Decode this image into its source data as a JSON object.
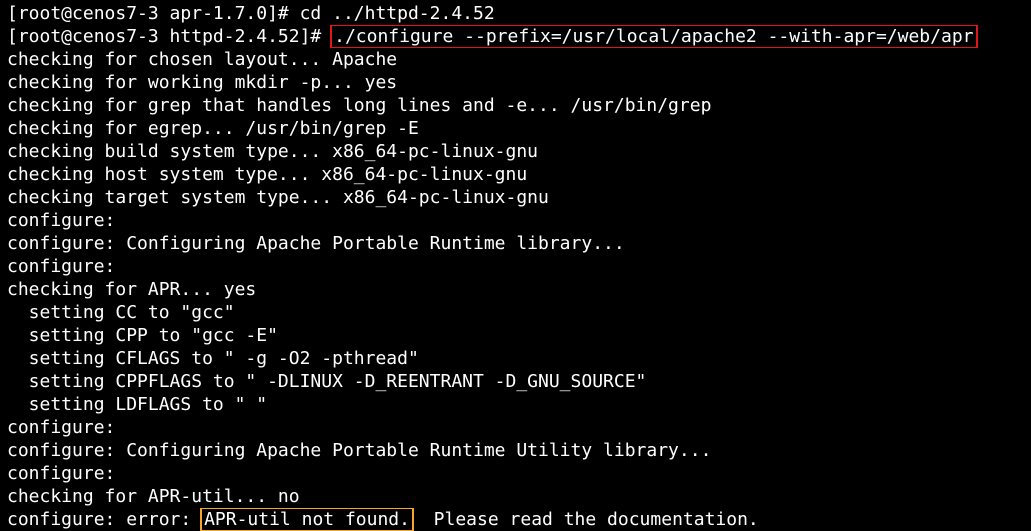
{
  "terminal": {
    "colors": {
      "background": "#000000",
      "foreground": "#ffffff",
      "highlight_red": "#e0161b",
      "highlight_orange": "#f5a623"
    },
    "lines": [
      "[root@cenos7-3 apr-1.7.0]# cd ../httpd-2.4.52",
      "[root@cenos7-3 httpd-2.4.52]# ",
      "checking for chosen layout... Apache",
      "checking for working mkdir -p... yes",
      "checking for grep that handles long lines and -e... /usr/bin/grep",
      "checking for egrep... /usr/bin/grep -E",
      "checking build system type... x86_64-pc-linux-gnu",
      "checking host system type... x86_64-pc-linux-gnu",
      "checking target system type... x86_64-pc-linux-gnu",
      "configure:",
      "configure: Configuring Apache Portable Runtime library...",
      "configure:",
      "checking for APR... yes",
      "  setting CC to \"gcc\"",
      "  setting CPP to \"gcc -E\"",
      "  setting CFLAGS to \" -g -O2 -pthread\"",
      "  setting CPPFLAGS to \" -DLINUX -D_REENTRANT -D_GNU_SOURCE\"",
      "  setting LDFLAGS to \" \"",
      "configure:",
      "configure: Configuring Apache Portable Runtime Utility library...",
      "configure:",
      "checking for APR-util... no",
      "configure: error: "
    ],
    "highlighted_command": "./configure --prefix=/usr/local/apache2 --with-apr=/web/apr",
    "highlighted_error": "APR-util not found.",
    "error_tail": "  Please read the documentation."
  }
}
